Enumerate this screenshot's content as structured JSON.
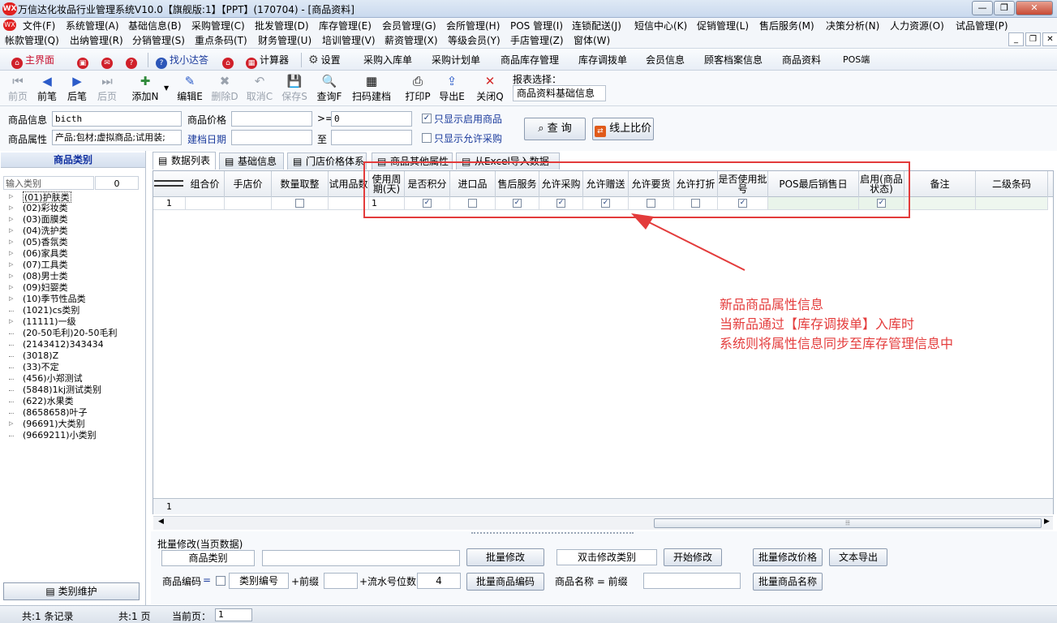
{
  "window": {
    "logo": "WX",
    "title": "万信达化妆品行业管理系统V10.0【旗舰版:1】【PPT】(170704) - [商品资料]",
    "controls": [
      "—",
      "❐",
      "✕"
    ],
    "mdi_controls": [
      "_",
      "❐",
      "✕"
    ]
  },
  "menu": {
    "row1": [
      "文件(F)",
      "系统管理(A)",
      "基础信息(B)",
      "采购管理(C)",
      "批发管理(D)",
      "库存管理(E)",
      "会员管理(G)",
      "会所管理(H)",
      "POS 管理(I)",
      "连锁配送(J)",
      "短信中心(K)",
      "促销管理(L)",
      "售后服务(M)",
      "决策分析(N)",
      "人力资源(O)",
      "试品管理(P)"
    ],
    "row2": [
      "帐款管理(Q)",
      "出纳管理(R)",
      "分销管理(S)",
      "重点条码(T)",
      "财务管理(U)",
      "培训管理(V)",
      "薪资管理(X)",
      "等级会员(Y)",
      "手店管理(Z)",
      "窗体(W)"
    ]
  },
  "quickbar": {
    "home": "主界面",
    "find": "找小达答",
    "calculator": "计算器",
    "settings": "设置",
    "links": [
      "采购入库单",
      "采购计划单",
      "商品库存管理",
      "库存调拨单",
      "会员信息",
      "顾客档案信息",
      "商品资料",
      "POS端"
    ]
  },
  "toolbar": {
    "buttons": [
      {
        "label": "前页",
        "icon": "⏮",
        "disabled": true
      },
      {
        "label": "前笔",
        "icon": "◀",
        "disabled": false
      },
      {
        "label": "后笔",
        "icon": "▶",
        "disabled": false
      },
      {
        "label": "后页",
        "icon": "⏭",
        "disabled": true
      },
      {
        "label": "添加N",
        "icon": "✚",
        "disabled": false
      },
      {
        "label": "编辑E",
        "icon": "✎",
        "disabled": false
      },
      {
        "label": "删除D",
        "icon": "✖",
        "disabled": true
      },
      {
        "label": "取消C",
        "icon": "↶",
        "disabled": true
      },
      {
        "label": "保存S",
        "icon": "💾",
        "disabled": true
      },
      {
        "label": "查询F",
        "icon": "🔍",
        "disabled": false
      },
      {
        "label": "扫码建档",
        "icon": "▦",
        "disabled": false
      },
      {
        "label": "打印P",
        "icon": "⎙",
        "disabled": false
      },
      {
        "label": "导出E",
        "icon": "⇪",
        "disabled": false
      },
      {
        "label": "关闭Q",
        "icon": "✕",
        "disabled": false
      }
    ],
    "report_label": "报表选择：",
    "report_value": "商品资料基础信息"
  },
  "filter": {
    "product_info_label": "商品信息",
    "product_info_value": "bicth",
    "product_price_label": "商品价格",
    "price_from": "",
    "gte": ">=",
    "price_to": "0",
    "only_enabled": "只显示启用商品",
    "only_enabled_checked": "✓",
    "product_attr_label": "商品属性",
    "product_attr_value": "产品;包材;虚拟商品;试用装;",
    "created_date_label": "建档日期",
    "date_from": "",
    "to_label": "至",
    "date_to": "",
    "only_allow_purchase": "只显示允许采购",
    "query_button": "查  询",
    "compare_button": "线上比价"
  },
  "category_panel": {
    "header": "商品类别",
    "input_placeholder": "输入类别",
    "count": "0",
    "nodes": [
      {
        "label": "(01)护肤类",
        "expand": "▷"
      },
      {
        "label": "(02)彩妆类",
        "expand": "▷"
      },
      {
        "label": "(03)面膜类",
        "expand": "▷"
      },
      {
        "label": "(04)洗护类",
        "expand": "▷"
      },
      {
        "label": "(05)香氛类",
        "expand": "▷"
      },
      {
        "label": "(06)家具类",
        "expand": "▷"
      },
      {
        "label": "(07)工具类",
        "expand": "▷"
      },
      {
        "label": "(08)男士类",
        "expand": "▷"
      },
      {
        "label": "(09)妇婴类",
        "expand": "▷"
      },
      {
        "label": "(10)季节性品类",
        "expand": "▷"
      },
      {
        "label": "(1021)cs类别",
        "expand": ""
      },
      {
        "label": "(11111)一级",
        "expand": "▷"
      },
      {
        "label": "(20-50毛利)20-50毛利",
        "expand": ""
      },
      {
        "label": "(2143412)343434",
        "expand": ""
      },
      {
        "label": "(3018)Z",
        "expand": ""
      },
      {
        "label": "(33)不定",
        "expand": ""
      },
      {
        "label": "(456)小郑测试",
        "expand": ""
      },
      {
        "label": "(5848)1kj测试类别",
        "expand": ""
      },
      {
        "label": "(622)水果类",
        "expand": ""
      },
      {
        "label": "(8658658)叶子",
        "expand": ""
      },
      {
        "label": "(96691)大类别",
        "expand": "▷"
      },
      {
        "label": "(9669211)小类别",
        "expand": ""
      }
    ],
    "maintain_button": "类别维护"
  },
  "tabs": [
    "数据列表",
    "基础信息",
    "门店价格体系",
    "商品其他属性",
    "从Excel导入数据"
  ],
  "grid": {
    "columns": [
      "组合价",
      "手店价",
      "数量取整",
      "试用品数",
      "使用周期(天)",
      "是否积分",
      "进口品",
      "售后服务",
      "允许采购",
      "允许赠送",
      "允许要货",
      "允许打折",
      "是否使用批号",
      "POS最后销售日",
      "启用(商品状态)",
      "备注",
      "二级条码"
    ],
    "row_number": "1",
    "cycle_value": "1",
    "check_glyph": "✓",
    "checked": [
      false,
      true,
      false,
      true,
      true,
      true,
      false,
      false,
      true,
      true
    ],
    "footer_number": "1"
  },
  "annotation": {
    "lines": [
      "新品商品属性信息",
      "当新品通过【库存调拨单】入库时",
      "系统则将属性信息同步至库存管理信息中"
    ]
  },
  "batch": {
    "title": "批量修改(当页数据)",
    "category_field": "商品类别",
    "batch_modify_button": "批量修改",
    "double_click_field": "双击修改类别",
    "start_modify_button": "开始修改",
    "batch_price_button": "批量修改价格",
    "text_export_button": "文本导出",
    "code_label": "商品编码",
    "equals": "=",
    "category_code_field": "类别编号",
    "plus_prefix": "+前缀",
    "plus_serial": "+流水号位数",
    "serial_digits": "4",
    "batch_code_button": "批量商品编码",
    "name_label": "商品名称 = 前缀",
    "batch_name_button": "批量商品名称"
  },
  "status": {
    "records": "共:1 条记录",
    "pages": "共:1 页",
    "current_page_label": "当前页：",
    "current_page": "1"
  }
}
